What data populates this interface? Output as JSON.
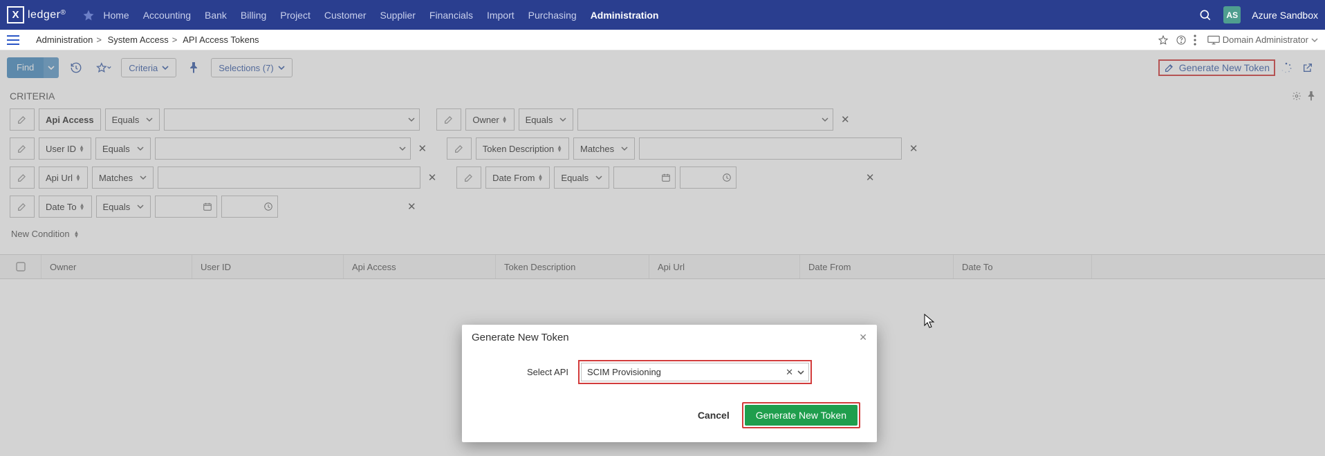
{
  "navbar": {
    "brand": "ledger",
    "items": [
      "Home",
      "Accounting",
      "Bank",
      "Billing",
      "Project",
      "Customer",
      "Supplier",
      "Financials",
      "Import",
      "Purchasing",
      "Administration"
    ],
    "active_index": 10,
    "account_initials": "AS",
    "account_name": "Azure Sandbox"
  },
  "crumbbar": {
    "items": [
      "Administration",
      "System Access",
      "API Access Tokens"
    ],
    "role": "Domain Administrator"
  },
  "toolbar": {
    "find": "Find",
    "criteria": "Criteria",
    "selections": "Selections (7)",
    "generate": "Generate New Token"
  },
  "criteria": {
    "title": "CRITERIA",
    "new_condition": "New Condition",
    "rows": [
      {
        "left": {
          "label": "Api Access",
          "bold": true,
          "op": "Equals",
          "sort": false,
          "val_type": "wide"
        },
        "right": {
          "label": "Owner",
          "op": "Equals",
          "sort": true,
          "val_type": "wide"
        }
      },
      {
        "left": {
          "label": "User ID",
          "op": "Equals",
          "sort": true,
          "val_type": "wide",
          "close": true
        },
        "right": {
          "label": "Token Description",
          "op": "Matches",
          "sort": true,
          "val_type": "wide",
          "close": true
        }
      },
      {
        "left": {
          "label": "Api Url",
          "op": "Matches",
          "sort": true,
          "val_type": "wide",
          "close": true
        },
        "right": {
          "label": "Date From",
          "op": "Equals",
          "sort": true,
          "val_type": "date",
          "close": true
        }
      },
      {
        "left": {
          "label": "Date To",
          "op": "Equals",
          "sort": true,
          "val_type": "date",
          "close": true
        }
      }
    ]
  },
  "grid": {
    "columns": [
      "Owner",
      "User ID",
      "Api Access",
      "Token Description",
      "Api Url",
      "Date From",
      "Date To"
    ]
  },
  "dialog": {
    "title": "Generate New Token",
    "field_label": "Select API",
    "field_value": "SCIM Provisioning",
    "cancel": "Cancel",
    "submit": "Generate New Token"
  }
}
